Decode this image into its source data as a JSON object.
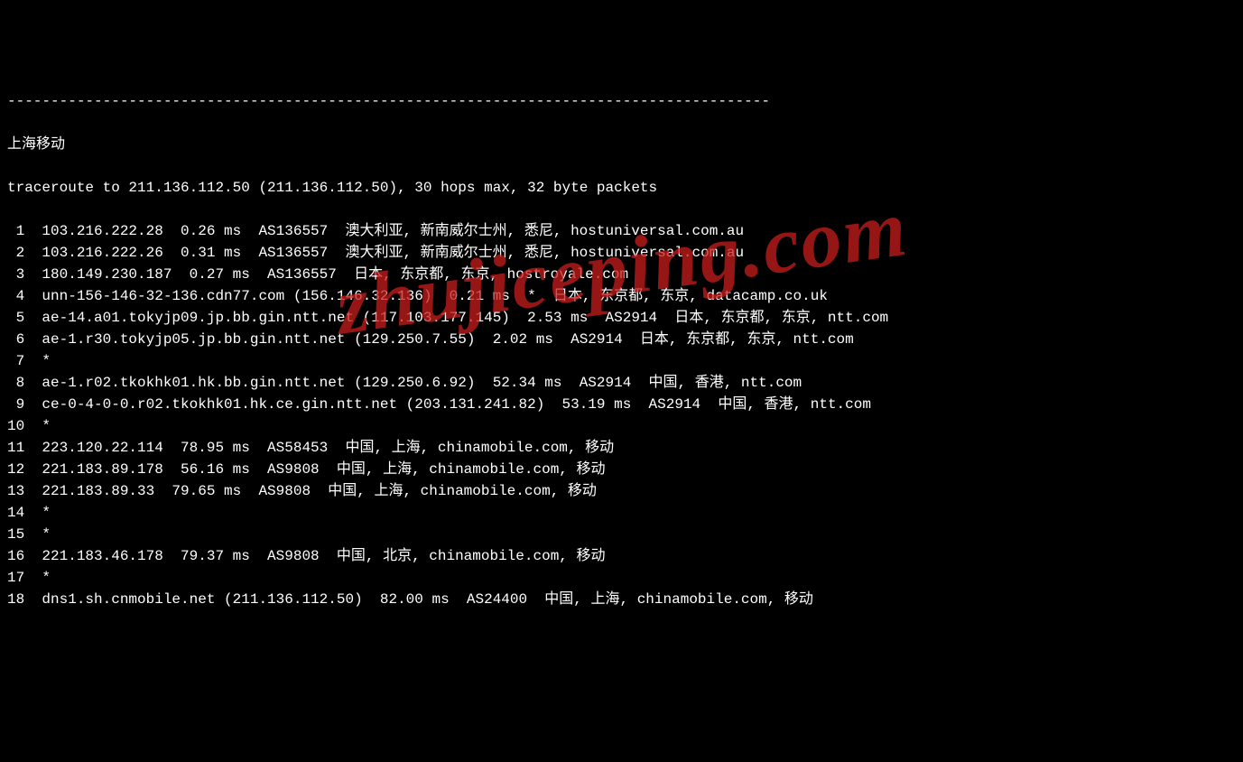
{
  "separator": "----------------------------------------------------------------------------------------",
  "title": "上海移动",
  "header": "traceroute to 211.136.112.50 (211.136.112.50), 30 hops max, 32 byte packets",
  "watermark": "zhujiceping.com",
  "hops": [
    {
      "n": " 1",
      "text": "103.216.222.28  0.26 ms  AS136557  澳大利亚, 新南威尔士州, 悉尼, hostuniversal.com.au"
    },
    {
      "n": " 2",
      "text": "103.216.222.26  0.31 ms  AS136557  澳大利亚, 新南威尔士州, 悉尼, hostuniversal.com.au"
    },
    {
      "n": " 3",
      "text": "180.149.230.187  0.27 ms  AS136557  日本, 东京都, 东京, hostroyale.com"
    },
    {
      "n": " 4",
      "text": "unn-156-146-32-136.cdn77.com (156.146.32.136)  0.21 ms  *  日本, 东京都, 东京, datacamp.co.uk"
    },
    {
      "n": " 5",
      "text": "ae-14.a01.tokyjp09.jp.bb.gin.ntt.net (117.103.177.145)  2.53 ms  AS2914  日本, 东京都, 东京, ntt.com"
    },
    {
      "n": " 6",
      "text": "ae-1.r30.tokyjp05.jp.bb.gin.ntt.net (129.250.7.55)  2.02 ms  AS2914  日本, 东京都, 东京, ntt.com"
    },
    {
      "n": " 7",
      "text": "*"
    },
    {
      "n": " 8",
      "text": "ae-1.r02.tkokhk01.hk.bb.gin.ntt.net (129.250.6.92)  52.34 ms  AS2914  中国, 香港, ntt.com"
    },
    {
      "n": " 9",
      "text": "ce-0-4-0-0.r02.tkokhk01.hk.ce.gin.ntt.net (203.131.241.82)  53.19 ms  AS2914  中国, 香港, ntt.com"
    },
    {
      "n": "10",
      "text": "*"
    },
    {
      "n": "11",
      "text": "223.120.22.114  78.95 ms  AS58453  中国, 上海, chinamobile.com, 移动"
    },
    {
      "n": "12",
      "text": "221.183.89.178  56.16 ms  AS9808  中国, 上海, chinamobile.com, 移动"
    },
    {
      "n": "13",
      "text": "221.183.89.33  79.65 ms  AS9808  中国, 上海, chinamobile.com, 移动"
    },
    {
      "n": "14",
      "text": "*"
    },
    {
      "n": "15",
      "text": "*"
    },
    {
      "n": "16",
      "text": "221.183.46.178  79.37 ms  AS9808  中国, 北京, chinamobile.com, 移动"
    },
    {
      "n": "17",
      "text": "*"
    },
    {
      "n": "18",
      "text": "dns1.sh.cnmobile.net (211.136.112.50)  82.00 ms  AS24400  中国, 上海, chinamobile.com, 移动"
    }
  ]
}
